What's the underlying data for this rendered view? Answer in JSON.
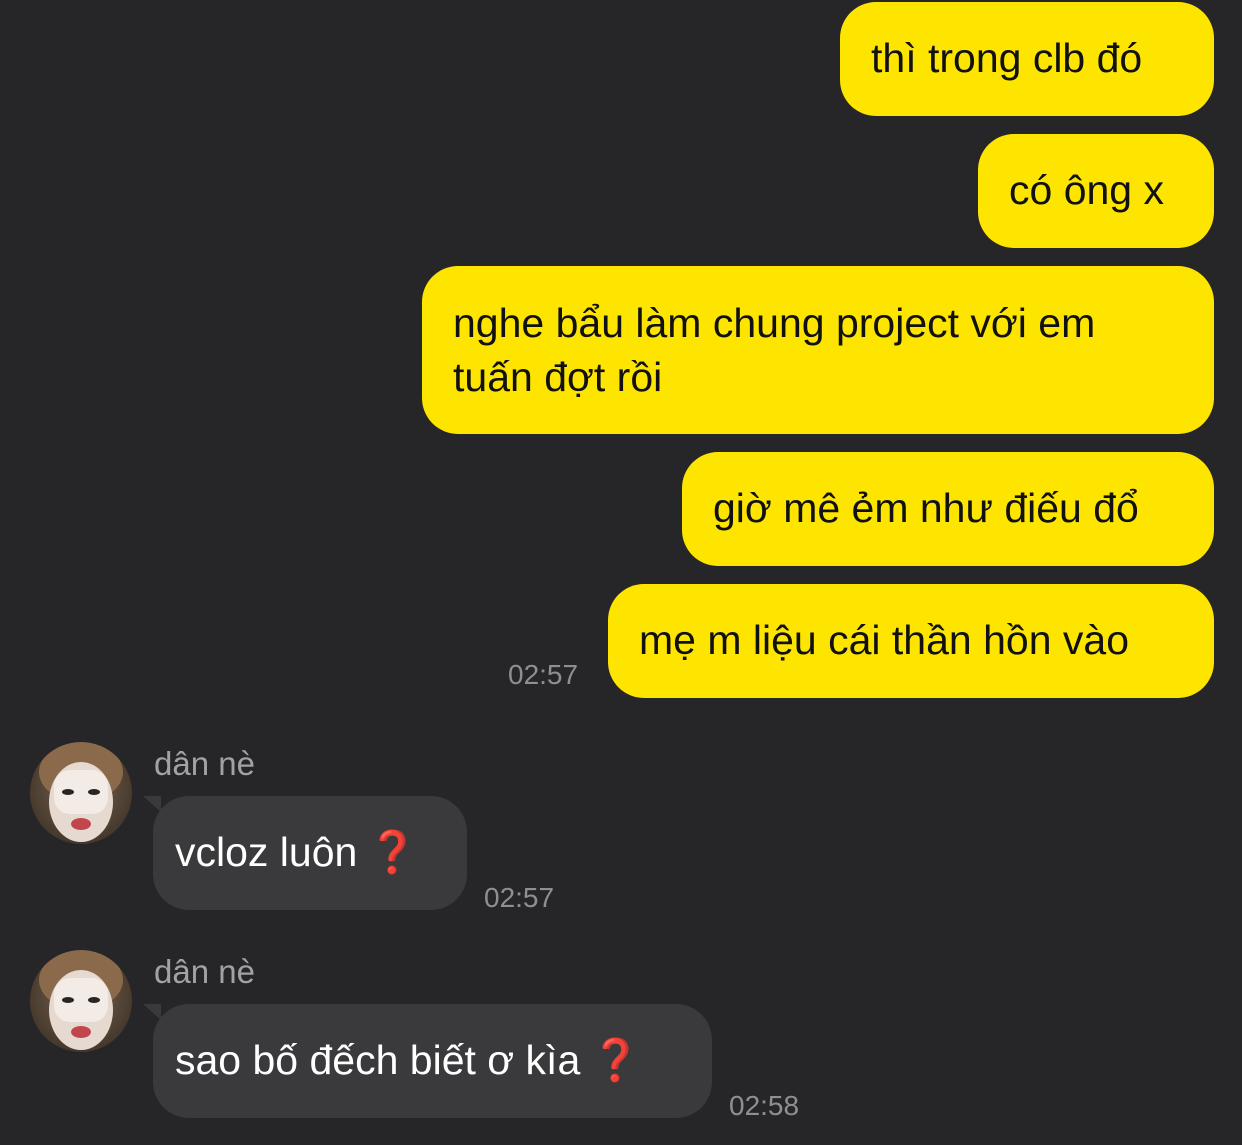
{
  "chat": {
    "outgoing": [
      {
        "text": "thì trong clb đó"
      },
      {
        "text": "có ông x"
      },
      {
        "text": "nghe bẩu làm chung project với em tuấn đợt rồi"
      },
      {
        "text": "giờ mê ẻm như điếu đổ"
      },
      {
        "text": "mẹ m liệu cái thần hồn vào",
        "time": "02:57"
      }
    ],
    "incoming": [
      {
        "sender": "dân nè",
        "text": "vcloz luôn",
        "emoji": "❓",
        "time": "02:57",
        "avatar_icon": "contact-photo"
      },
      {
        "sender": "dân nè",
        "text": "sao bố đếch biết ơ kìa",
        "emoji": "❓",
        "time": "02:58",
        "avatar_icon": "contact-photo"
      }
    ]
  },
  "colors": {
    "background": "#262628",
    "outgoing_bubble": "#FEE500",
    "incoming_bubble": "#3A3A3C",
    "timestamp": "#8E8E93",
    "emoji_red": "#E0161A"
  }
}
